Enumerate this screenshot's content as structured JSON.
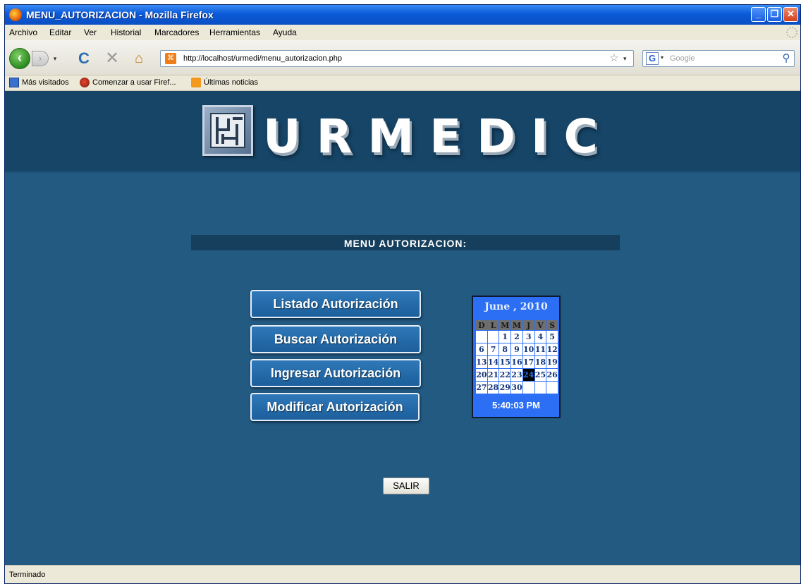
{
  "window": {
    "title": "MENU_AUTORIZACION - Mozilla Firefox",
    "minimize": "_",
    "maximize": "❐",
    "close": "✕"
  },
  "menubar": {
    "items": [
      "Archivo",
      "Editar",
      "Ver",
      "Historial",
      "Marcadores",
      "Herramientas",
      "Ayuda"
    ]
  },
  "navbar": {
    "url": "http://localhost/urmedi/menu_autorizacion.php",
    "search_placeholder": "Google",
    "icons": {
      "back": "‹",
      "forward": "›",
      "reload": "C",
      "stop": "✕",
      "home": "⌂",
      "star": "☆",
      "search_engine": "G",
      "search_go": "⚲",
      "dropdown": "▾"
    }
  },
  "bookmarks": {
    "items": [
      "Más visitados",
      "Comenzar a usar Firef...",
      "Últimas noticias"
    ]
  },
  "page": {
    "logo_text": "URMEDIC",
    "menu_title": "MENU AUTORIZACION:",
    "buttons": {
      "listado": "Listado Autorización",
      "buscar": "Buscar Autorización",
      "ingresar": "Ingresar Autorización",
      "modificar": "Modificar Autorización",
      "salir": "SALIR"
    },
    "calendar": {
      "title": "June , 2010",
      "weekdays": [
        "D",
        "L",
        "M",
        "M",
        "J",
        "V",
        "S"
      ],
      "weeks": [
        [
          "",
          "",
          "1",
          "2",
          "3",
          "4",
          "5"
        ],
        [
          "6",
          "7",
          "8",
          "9",
          "10",
          "11",
          "12"
        ],
        [
          "13",
          "14",
          "15",
          "16",
          "17",
          "18",
          "19"
        ],
        [
          "20",
          "21",
          "22",
          "23",
          "24",
          "25",
          "26"
        ],
        [
          "27",
          "28",
          "29",
          "30",
          "",
          "",
          ""
        ]
      ],
      "today": "24",
      "time": "5:40:03 PM"
    }
  },
  "status": {
    "text": "Terminado"
  }
}
